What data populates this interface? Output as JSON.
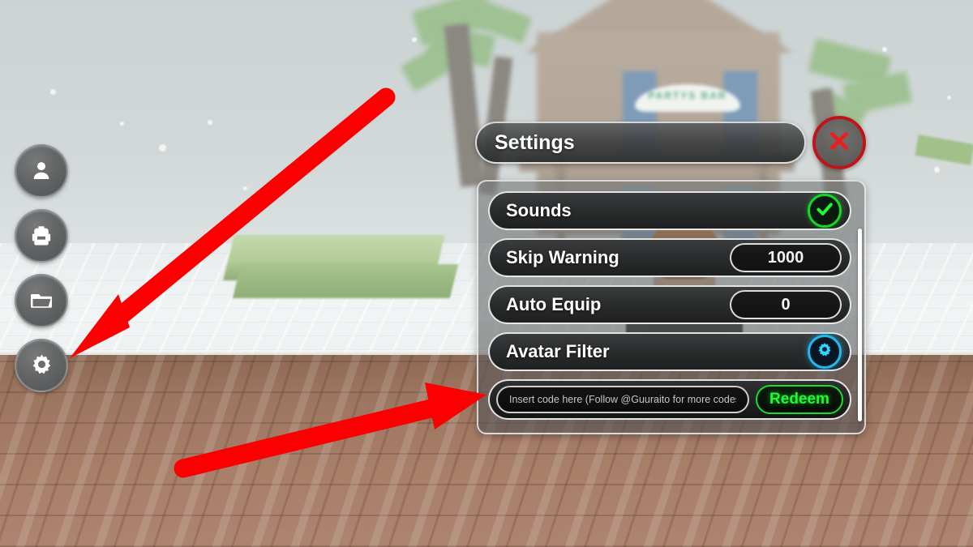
{
  "scene": {
    "building_sign": "PARTYS BAR",
    "colors": {
      "sky": "#ccd3d4",
      "snow": "#eceff0",
      "dirt": "#a87f69",
      "foliage": "#9fc193",
      "arrow_red": "#fb0000",
      "accent_green": "#17d62a",
      "accent_cyan": "#1fb9ef",
      "close_red": "#c0141b"
    }
  },
  "sidebar": {
    "items": [
      {
        "icon": "person-icon",
        "name": "sidebar-item-character"
      },
      {
        "icon": "backpack-icon",
        "name": "sidebar-item-inventory"
      },
      {
        "icon": "folder-icon",
        "name": "sidebar-item-codes"
      },
      {
        "icon": "gear-icon",
        "name": "sidebar-item-settings"
      }
    ]
  },
  "settings": {
    "title": "Settings",
    "close_icon": "close-x-icon",
    "rows": [
      {
        "label": "Sounds",
        "control": "toggle",
        "value": "",
        "icon": "check-icon"
      },
      {
        "label": "Skip Warning",
        "control": "value",
        "value": "1000",
        "icon": ""
      },
      {
        "label": "Auto Equip",
        "control": "value",
        "value": "0",
        "icon": ""
      },
      {
        "label": "Avatar Filter",
        "control": "button",
        "value": "",
        "icon": "gear-icon"
      }
    ],
    "code_input": {
      "placeholder": "Insert code here (Follow @Guuraito for more codes)",
      "value": ""
    },
    "redeem_label": "Redeem"
  },
  "annotations": {
    "arrow_1_target": "settings-gear-button",
    "arrow_2_target": "code-input-field"
  }
}
